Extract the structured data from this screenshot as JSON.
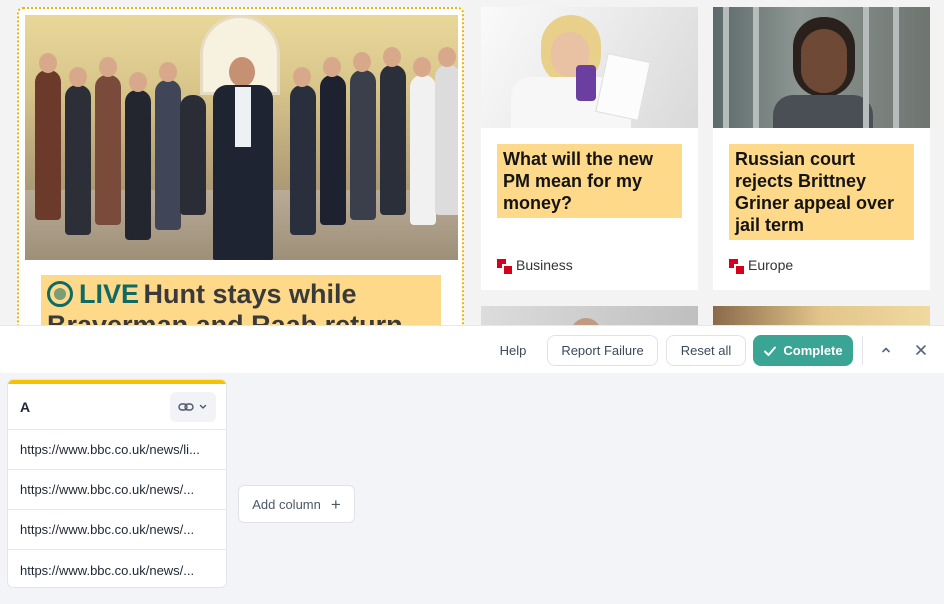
{
  "bbc_page": {
    "lead_story": {
      "live_label": "LIVE",
      "headline": "Hunt stays while Braverman and Raab return"
    },
    "cards": [
      {
        "headline": "What will the new PM mean for my money?",
        "tag": "Business"
      },
      {
        "headline": "Russian court rejects Brittney Griner appeal over jail term",
        "tag": "Europe"
      }
    ]
  },
  "toolbar": {
    "help_label": "Help",
    "report_failure_label": "Report Failure",
    "reset_all_label": "Reset all",
    "complete_label": "Complete",
    "collapse_icon": "chevron-up-icon",
    "close_icon": "close-icon"
  },
  "sheet": {
    "column_name": "A",
    "link_icon": "link-icon",
    "rows": [
      "https://www.bbc.co.uk/news/li...",
      "https://www.bbc.co.uk/news/...",
      "https://www.bbc.co.uk/news/...",
      "https://www.bbc.co.uk/news/..."
    ],
    "add_column_label": "Add column"
  },
  "colors": {
    "accent": "#3aa595",
    "headline_bg": "#ffd98a",
    "column_bar": "#f6c200",
    "bbc_red": "#d6001c",
    "live_green": "#0d6b64"
  }
}
